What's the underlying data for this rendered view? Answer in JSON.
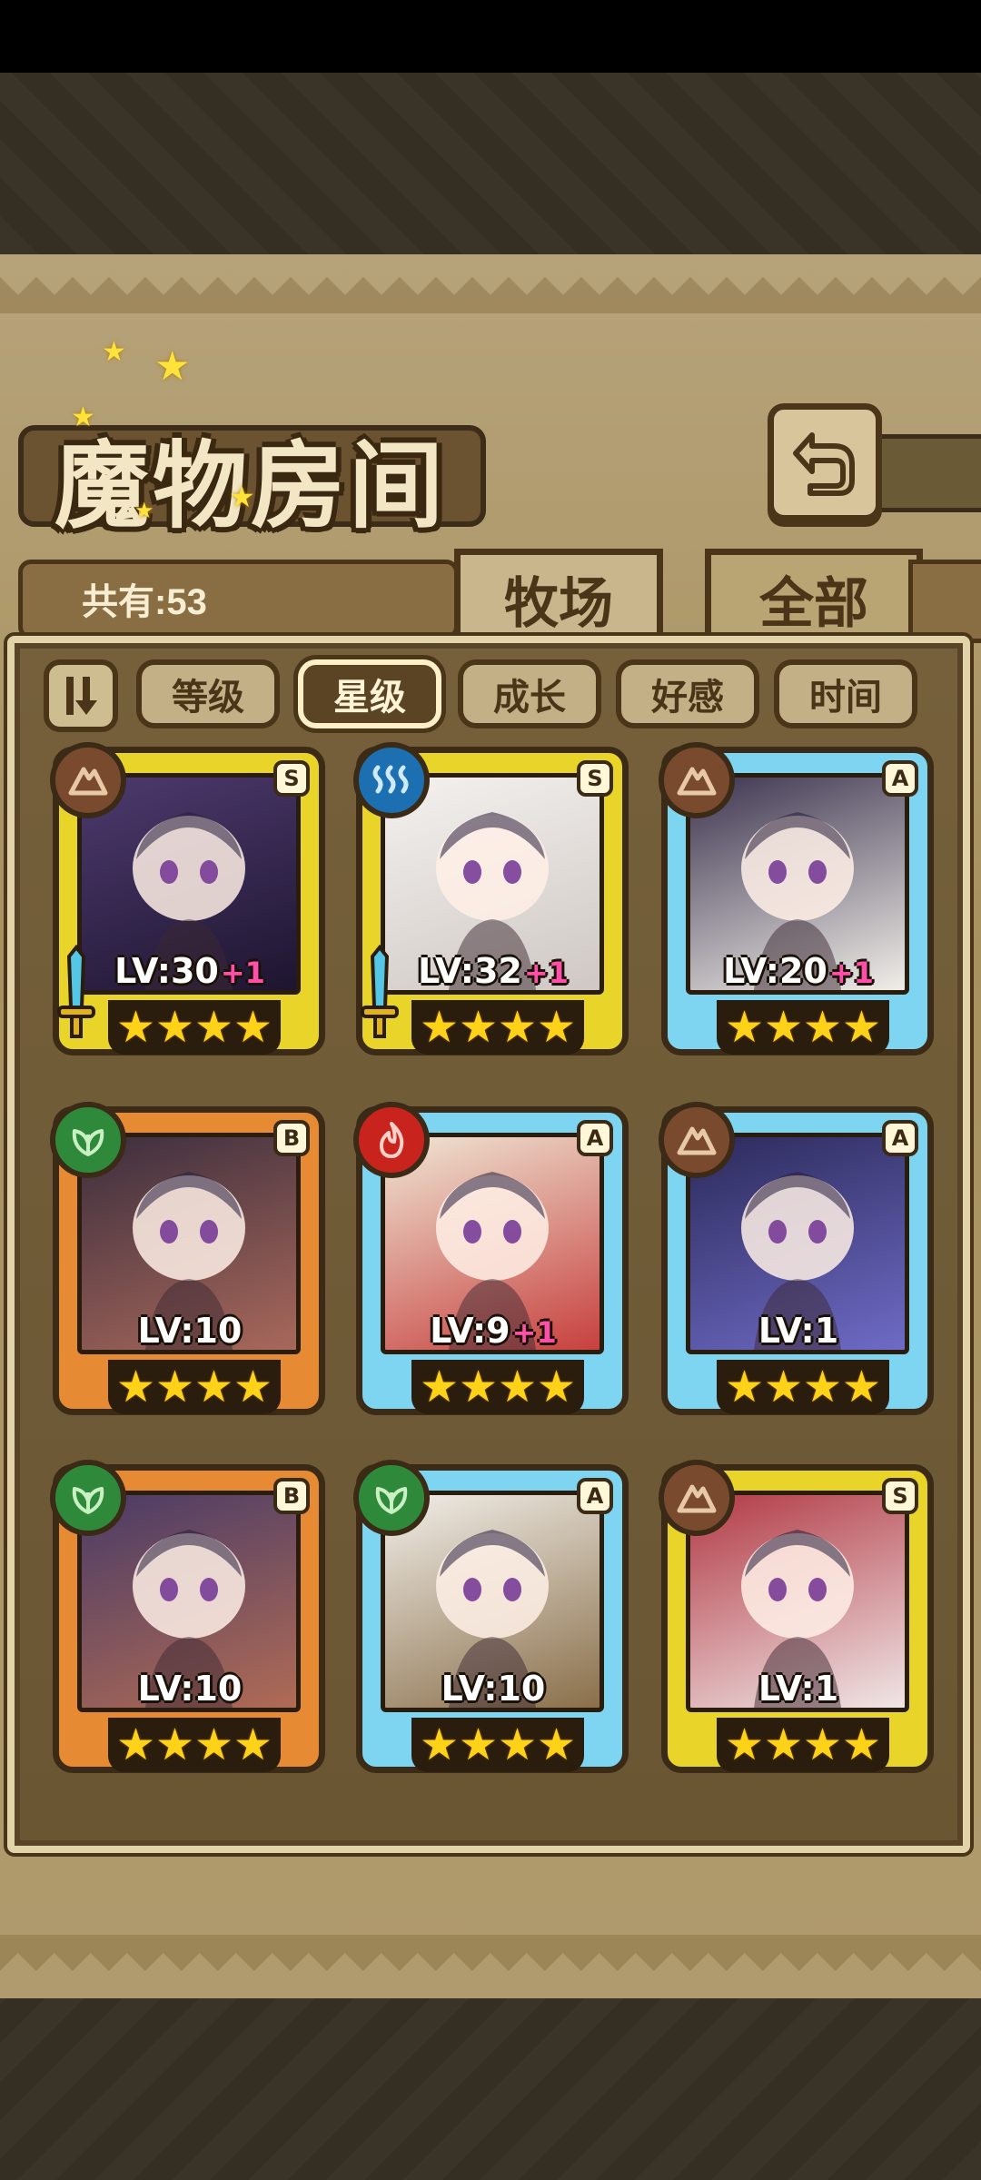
{
  "header": {
    "title": "魔物房间",
    "back_icon": "return-arrow-icon"
  },
  "summary": {
    "count_label": "共有:53"
  },
  "tabs": [
    {
      "label": "牧场"
    },
    {
      "label": "全部"
    }
  ],
  "sort_options": [
    {
      "label": "等级",
      "active": false
    },
    {
      "label": "星级",
      "active": true
    },
    {
      "label": "成长",
      "active": false
    },
    {
      "label": "好感",
      "active": false
    },
    {
      "label": "时间",
      "active": false
    }
  ],
  "monsters": [
    {
      "rank": "S",
      "element": "earth",
      "level": "LV:30",
      "bonus": "+1",
      "stars": "★★★★",
      "equipped": true
    },
    {
      "rank": "S",
      "element": "water",
      "level": "LV:32",
      "bonus": "+1",
      "stars": "★★★★",
      "equipped": true
    },
    {
      "rank": "A",
      "element": "earth",
      "level": "LV:20",
      "bonus": "+1",
      "stars": "★★★★",
      "equipped": false
    },
    {
      "rank": "B",
      "element": "nature",
      "level": "LV:10",
      "bonus": "",
      "stars": "★★★★",
      "equipped": false
    },
    {
      "rank": "A",
      "element": "fire",
      "level": "LV:9",
      "bonus": "+1",
      "stars": "★★★★",
      "equipped": false
    },
    {
      "rank": "A",
      "element": "earth",
      "level": "LV:1",
      "bonus": "",
      "stars": "★★★★",
      "equipped": false
    },
    {
      "rank": "B",
      "element": "nature",
      "level": "LV:10",
      "bonus": "",
      "stars": "★★★★",
      "equipped": false
    },
    {
      "rank": "A",
      "element": "nature",
      "level": "LV:10",
      "bonus": "",
      "stars": "★★★★",
      "equipped": false
    },
    {
      "rank": "S",
      "element": "earth",
      "level": "LV:1",
      "bonus": "",
      "stars": "★★★★",
      "equipped": false
    }
  ],
  "colors": {
    "rank_S": "#e9d42a",
    "rank_A": "#7dd5f1",
    "rank_B": "#e68a33",
    "star": "#ffd21a",
    "bonus": "#ff4fa8"
  }
}
